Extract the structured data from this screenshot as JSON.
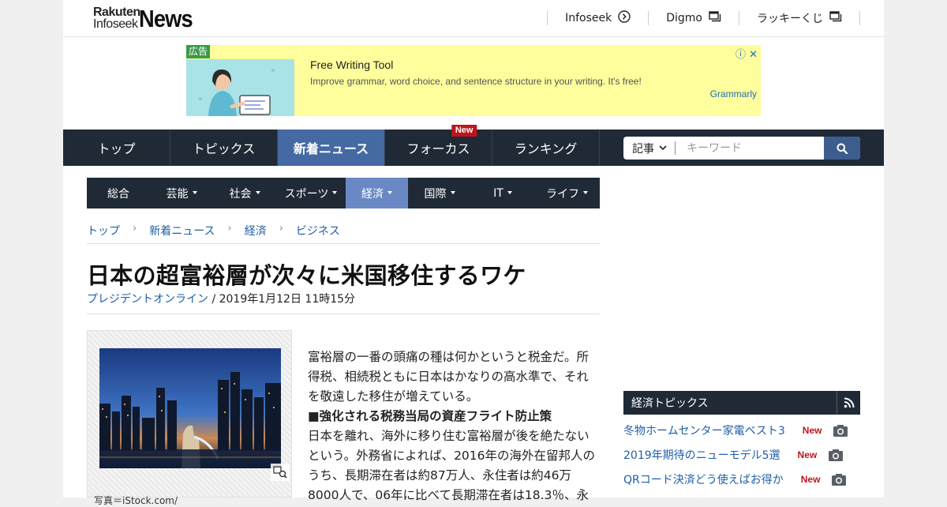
{
  "header": {
    "logo_small_1": "Rakuten",
    "logo_small_2": "Infoseek",
    "logo_big": "News",
    "links": [
      {
        "label": "Infoseek",
        "icon": "arrow-circle-right-icon"
      },
      {
        "label": "Digmo",
        "icon": "external-window-icon"
      },
      {
        "label": "ラッキーくじ",
        "icon": "external-window-icon"
      }
    ]
  },
  "ad": {
    "badge": "広告",
    "title": "Free Writing Tool",
    "description": "Improve grammar, word choice, and sentence structure in your writing. It's free!",
    "brand": "Grammarly",
    "close": "ⓘ ✕"
  },
  "nav": {
    "items": [
      "トップ",
      "トピックス",
      "新着ニュース",
      "フォーカス",
      "ランキング"
    ],
    "active_index": 2,
    "new_badge": "New"
  },
  "search": {
    "select_value": "記事",
    "placeholder": "キーワード"
  },
  "subnav": {
    "items": [
      "総合",
      "芸能",
      "社会",
      "スポーツ",
      "経済",
      "国際",
      "IT",
      "ライフ"
    ],
    "active_index": 4
  },
  "breadcrumb": [
    "トップ",
    "新着ニュース",
    "経済",
    "ビジネス"
  ],
  "article": {
    "title": "日本の超富裕層が次々に米国移住するワケ",
    "source": "プレジデントオンライン",
    "date": " / 2019年1月12日 11時15分",
    "caption": "写真＝iStock.com/",
    "paragraphs": [
      {
        "kind": "text",
        "text": "富裕層の一番の頭痛の種は何かというと税金だ。所得税、相続税ともに日本はかなりの高水準で、それを敬遠した移住が増えている。"
      },
      {
        "kind": "heading",
        "text": "■強化される税務当局の資産フライト防止策"
      },
      {
        "kind": "text",
        "text": "日本を離れ、海外に移り住む富裕層が後を絶たないという。外務省によれば、2016年の海外在留邦人のうち、長期滞在者は約87万人、永住者は約46万8000人で、06年に比べて長期滞在者は18.3％、永"
      }
    ]
  },
  "sidebar": {
    "header": "経済トピックス",
    "topics": [
      {
        "title": "冬物ホームセンター家電ベスト3",
        "badge": "New"
      },
      {
        "title": "2019年期待のニューモデル5選",
        "badge": "New"
      },
      {
        "title": "QRコード決済どう使えばお得か",
        "badge": "New"
      }
    ]
  }
}
